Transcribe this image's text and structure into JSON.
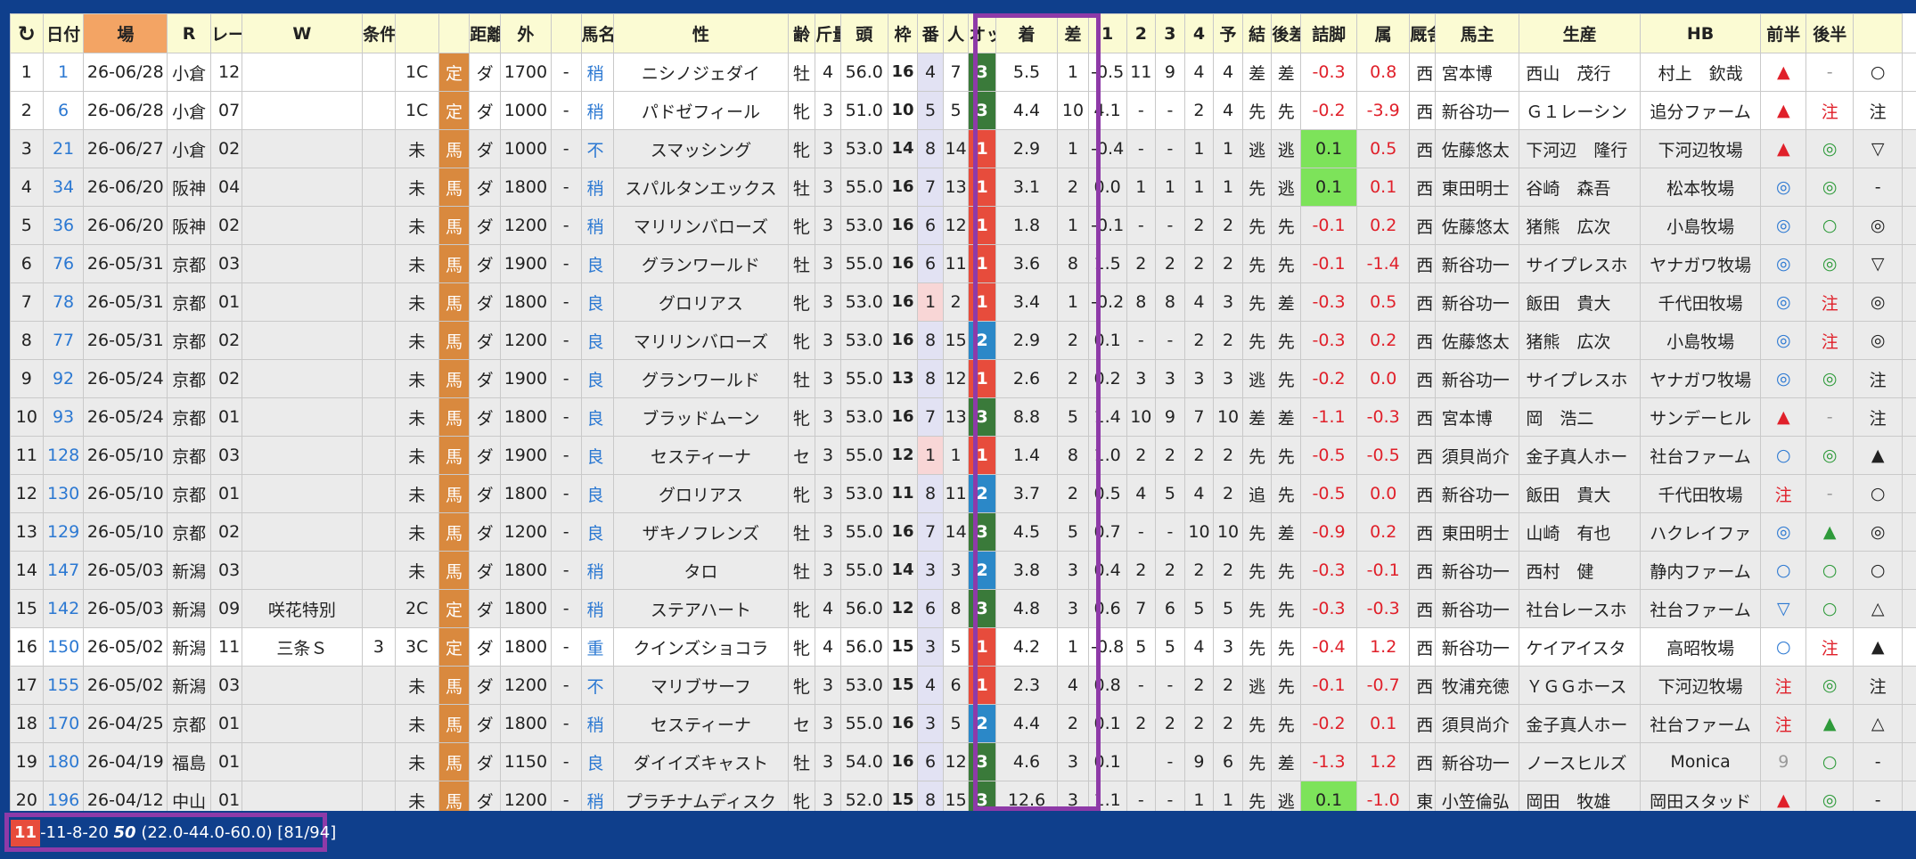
{
  "headers": [
    "",
    "日付",
    "場",
    "R",
    "レース名",
    "W",
    "条件",
    "",
    "",
    "距離",
    "外",
    "",
    "馬名",
    "性",
    "齢",
    "斤量",
    "頭",
    "枠",
    "番",
    "人",
    "オッズ",
    "着",
    "差",
    "1",
    "2",
    "3",
    "4",
    "予",
    "結",
    "後差",
    "詰脚",
    "属",
    "厩舎",
    "馬主",
    "生産",
    "HB",
    "前半",
    "後半",
    ""
  ],
  "refresh_icon": "↻",
  "rows": [
    [
      "1",
      "1",
      "26-06/28",
      "小倉",
      "12",
      "",
      "",
      "1C",
      "定",
      "ダ",
      "1700",
      "-",
      "稍",
      "ニシノジェダイ",
      "牡",
      "4",
      "56.0",
      "16",
      "4",
      "7",
      "3",
      "5.5",
      "1",
      "-0.5",
      "11",
      "9",
      "4",
      "4",
      "差",
      "差",
      "-0.3",
      "0.8",
      "西",
      "宮本博",
      "西山　茂行",
      "村上　欽哉",
      "▲",
      "-",
      "○"
    ],
    [
      "2",
      "6",
      "26-06/28",
      "小倉",
      "07",
      "",
      "",
      "1C",
      "定",
      "ダ",
      "1000",
      "-",
      "稍",
      "パドゼフィール",
      "牝",
      "3",
      "51.0",
      "10",
      "5",
      "5",
      "3",
      "4.4",
      "10",
      "4.1",
      "-",
      "-",
      "2",
      "4",
      "先",
      "先",
      "-0.2",
      "-3.9",
      "西",
      "新谷功一",
      "Ｇ１レーシン",
      "追分ファーム",
      "▲",
      "注",
      "注"
    ],
    [
      "3",
      "21",
      "26-06/27",
      "小倉",
      "02",
      "",
      "",
      "未",
      "馬",
      "ダ",
      "1000",
      "-",
      "不",
      "スマッシング",
      "牝",
      "3",
      "53.0",
      "14",
      "8",
      "14",
      "1",
      "2.9",
      "1",
      "-0.4",
      "-",
      "-",
      "1",
      "1",
      "逃",
      "逃",
      "0.1",
      "0.5",
      "西",
      "佐藤悠太",
      "下河辺　隆行",
      "下河辺牧場",
      "▲",
      "◎",
      "▽"
    ],
    [
      "4",
      "34",
      "26-06/20",
      "阪神",
      "04",
      "",
      "",
      "未",
      "馬",
      "ダ",
      "1800",
      "-",
      "稍",
      "スパルタンエックス",
      "牡",
      "3",
      "55.0",
      "16",
      "7",
      "13",
      "1",
      "3.1",
      "2",
      "0.0",
      "1",
      "1",
      "1",
      "1",
      "先",
      "逃",
      "0.1",
      "0.1",
      "西",
      "東田明士",
      "谷崎　森吾",
      "松本牧場",
      "◎",
      "◎",
      "-"
    ],
    [
      "5",
      "36",
      "26-06/20",
      "阪神",
      "02",
      "",
      "",
      "未",
      "馬",
      "ダ",
      "1200",
      "-",
      "稍",
      "マリリンバローズ",
      "牝",
      "3",
      "53.0",
      "16",
      "6",
      "12",
      "1",
      "1.8",
      "1",
      "-0.1",
      "-",
      "-",
      "2",
      "2",
      "先",
      "先",
      "-0.1",
      "0.2",
      "西",
      "佐藤悠太",
      "猪熊　広次",
      "小島牧場",
      "◎",
      "○",
      "◎"
    ],
    [
      "6",
      "76",
      "26-05/31",
      "京都",
      "03",
      "",
      "",
      "未",
      "馬",
      "ダ",
      "1900",
      "-",
      "良",
      "グランワールド",
      "牡",
      "3",
      "55.0",
      "16",
      "6",
      "11",
      "1",
      "3.6",
      "8",
      "1.5",
      "2",
      "2",
      "2",
      "2",
      "先",
      "先",
      "-0.1",
      "-1.4",
      "西",
      "新谷功一",
      "サイプレスホ",
      "ヤナガワ牧場",
      "◎",
      "◎",
      "▽"
    ],
    [
      "7",
      "78",
      "26-05/31",
      "京都",
      "01",
      "",
      "",
      "未",
      "馬",
      "ダ",
      "1800",
      "-",
      "良",
      "グロリアス",
      "牝",
      "3",
      "53.0",
      "16",
      "1",
      "2",
      "1",
      "3.4",
      "1",
      "-0.2",
      "8",
      "8",
      "4",
      "3",
      "先",
      "差",
      "-0.3",
      "0.5",
      "西",
      "新谷功一",
      "飯田　貴大",
      "千代田牧場",
      "◎",
      "注",
      "◎"
    ],
    [
      "8",
      "77",
      "26-05/31",
      "京都",
      "02",
      "",
      "",
      "未",
      "馬",
      "ダ",
      "1200",
      "-",
      "良",
      "マリリンバローズ",
      "牝",
      "3",
      "53.0",
      "16",
      "8",
      "15",
      "2",
      "2.9",
      "2",
      "0.1",
      "-",
      "-",
      "2",
      "2",
      "先",
      "先",
      "-0.3",
      "0.2",
      "西",
      "佐藤悠太",
      "猪熊　広次",
      "小島牧場",
      "◎",
      "注",
      "◎"
    ],
    [
      "9",
      "92",
      "26-05/24",
      "京都",
      "02",
      "",
      "",
      "未",
      "馬",
      "ダ",
      "1900",
      "-",
      "良",
      "グランワールド",
      "牡",
      "3",
      "55.0",
      "13",
      "8",
      "12",
      "1",
      "2.6",
      "2",
      "0.2",
      "3",
      "3",
      "3",
      "3",
      "逃",
      "先",
      "-0.2",
      "0.0",
      "西",
      "新谷功一",
      "サイプレスホ",
      "ヤナガワ牧場",
      "◎",
      "◎",
      "注"
    ],
    [
      "10",
      "93",
      "26-05/24",
      "京都",
      "01",
      "",
      "",
      "未",
      "馬",
      "ダ",
      "1800",
      "-",
      "良",
      "ブラッドムーン",
      "牝",
      "3",
      "53.0",
      "16",
      "7",
      "13",
      "3",
      "8.8",
      "5",
      "1.4",
      "10",
      "9",
      "7",
      "10",
      "差",
      "差",
      "-1.1",
      "-0.3",
      "西",
      "宮本博",
      "岡　浩二",
      "サンデーヒル",
      "▲",
      "-",
      "注"
    ],
    [
      "11",
      "128",
      "26-05/10",
      "京都",
      "03",
      "",
      "",
      "未",
      "馬",
      "ダ",
      "1900",
      "-",
      "良",
      "セスティーナ",
      "セ",
      "3",
      "55.0",
      "12",
      "1",
      "1",
      "1",
      "1.4",
      "8",
      "1.0",
      "2",
      "2",
      "2",
      "2",
      "先",
      "先",
      "-0.5",
      "-0.5",
      "西",
      "須貝尚介",
      "金子真人ホー",
      "社台ファーム",
      "○",
      "◎",
      "▲"
    ],
    [
      "12",
      "130",
      "26-05/10",
      "京都",
      "01",
      "",
      "",
      "未",
      "馬",
      "ダ",
      "1800",
      "-",
      "良",
      "グロリアス",
      "牝",
      "3",
      "53.0",
      "11",
      "8",
      "11",
      "2",
      "3.7",
      "2",
      "0.5",
      "4",
      "5",
      "4",
      "2",
      "追",
      "先",
      "-0.5",
      "0.0",
      "西",
      "新谷功一",
      "飯田　貴大",
      "千代田牧場",
      "注",
      "-",
      "○"
    ],
    [
      "13",
      "129",
      "26-05/10",
      "京都",
      "02",
      "",
      "",
      "未",
      "馬",
      "ダ",
      "1200",
      "-",
      "良",
      "ザキノフレンズ",
      "牡",
      "3",
      "55.0",
      "16",
      "7",
      "14",
      "3",
      "4.5",
      "5",
      "0.7",
      "-",
      "-",
      "10",
      "10",
      "先",
      "差",
      "-0.9",
      "0.2",
      "西",
      "東田明士",
      "山崎　有也",
      "ハクレイファ",
      "◎",
      "▲",
      "◎"
    ],
    [
      "14",
      "147",
      "26-05/03",
      "新潟",
      "03",
      "",
      "",
      "未",
      "馬",
      "ダ",
      "1800",
      "-",
      "稍",
      "タロ",
      "牡",
      "3",
      "55.0",
      "14",
      "3",
      "3",
      "2",
      "3.8",
      "3",
      "0.4",
      "2",
      "2",
      "2",
      "2",
      "先",
      "先",
      "-0.3",
      "-0.1",
      "西",
      "新谷功一",
      "西村　健",
      "静内ファーム",
      "○",
      "○",
      "○"
    ],
    [
      "15",
      "142",
      "26-05/03",
      "新潟",
      "09",
      "咲花特別",
      "",
      "2C",
      "定",
      "ダ",
      "1800",
      "-",
      "稍",
      "ステアハート",
      "牝",
      "4",
      "56.0",
      "12",
      "6",
      "8",
      "3",
      "4.8",
      "3",
      "0.6",
      "7",
      "6",
      "5",
      "5",
      "先",
      "先",
      "-0.3",
      "-0.3",
      "西",
      "新谷功一",
      "社台レースホ",
      "社台ファーム",
      "▽",
      "○",
      "△"
    ],
    [
      "16",
      "150",
      "26-05/02",
      "新潟",
      "11",
      "三条Ｓ",
      "3",
      "3C",
      "定",
      "ダ",
      "1800",
      "-",
      "重",
      "クインズショコラ",
      "牝",
      "4",
      "56.0",
      "15",
      "3",
      "5",
      "1",
      "4.2",
      "1",
      "-0.8",
      "5",
      "5",
      "4",
      "3",
      "先",
      "先",
      "-0.4",
      "1.2",
      "西",
      "新谷功一",
      "ケイアイスタ",
      "高昭牧場",
      "○",
      "注",
      "▲"
    ],
    [
      "17",
      "155",
      "26-05/02",
      "新潟",
      "03",
      "",
      "",
      "未",
      "馬",
      "ダ",
      "1200",
      "-",
      "不",
      "マリブサーフ",
      "牝",
      "3",
      "53.0",
      "15",
      "4",
      "6",
      "1",
      "2.3",
      "4",
      "0.8",
      "-",
      "-",
      "2",
      "2",
      "逃",
      "先",
      "-0.1",
      "-0.7",
      "西",
      "牧浦充徳",
      "ＹＧＧホース",
      "下河辺牧場",
      "注",
      "◎",
      "注"
    ],
    [
      "18",
      "170",
      "26-04/25",
      "京都",
      "01",
      "",
      "",
      "未",
      "馬",
      "ダ",
      "1800",
      "-",
      "稍",
      "セスティーナ",
      "セ",
      "3",
      "55.0",
      "16",
      "3",
      "5",
      "2",
      "4.4",
      "2",
      "0.1",
      "2",
      "2",
      "2",
      "2",
      "先",
      "先",
      "-0.2",
      "0.1",
      "西",
      "須貝尚介",
      "金子真人ホー",
      "社台ファーム",
      "注",
      "▲",
      "△"
    ],
    [
      "19",
      "180",
      "26-04/19",
      "福島",
      "01",
      "",
      "",
      "未",
      "馬",
      "ダ",
      "1150",
      "-",
      "良",
      "ダイイズキャスト",
      "牡",
      "3",
      "54.0",
      "16",
      "6",
      "12",
      "3",
      "4.6",
      "3",
      "0.1",
      "",
      "-",
      "9",
      "6",
      "先",
      "差",
      "-1.3",
      "1.2",
      "西",
      "新谷功一",
      "ノースヒルズ",
      "Monica",
      "9",
      "○",
      "-"
    ],
    [
      "20",
      "196",
      "26-04/12",
      "中山",
      "01",
      "",
      "",
      "未",
      "馬",
      "ダ",
      "1200",
      "-",
      "稍",
      "プラチナムディスク",
      "牝",
      "3",
      "52.0",
      "15",
      "8",
      "15",
      "3",
      "12.6",
      "3",
      "1.1",
      "-",
      "-",
      "1",
      "1",
      "先",
      "逃",
      "0.1",
      "-1.0",
      "東",
      "小笠倫弘",
      "岡田　牧雄",
      "岡田スタッド",
      "▲",
      "◎",
      "-"
    ]
  ],
  "status": {
    "badge": "11",
    "text1": "-11-8-20 ",
    "bold": "50",
    "text2": " (22.0-44.0-60.0) [81/94]"
  }
}
